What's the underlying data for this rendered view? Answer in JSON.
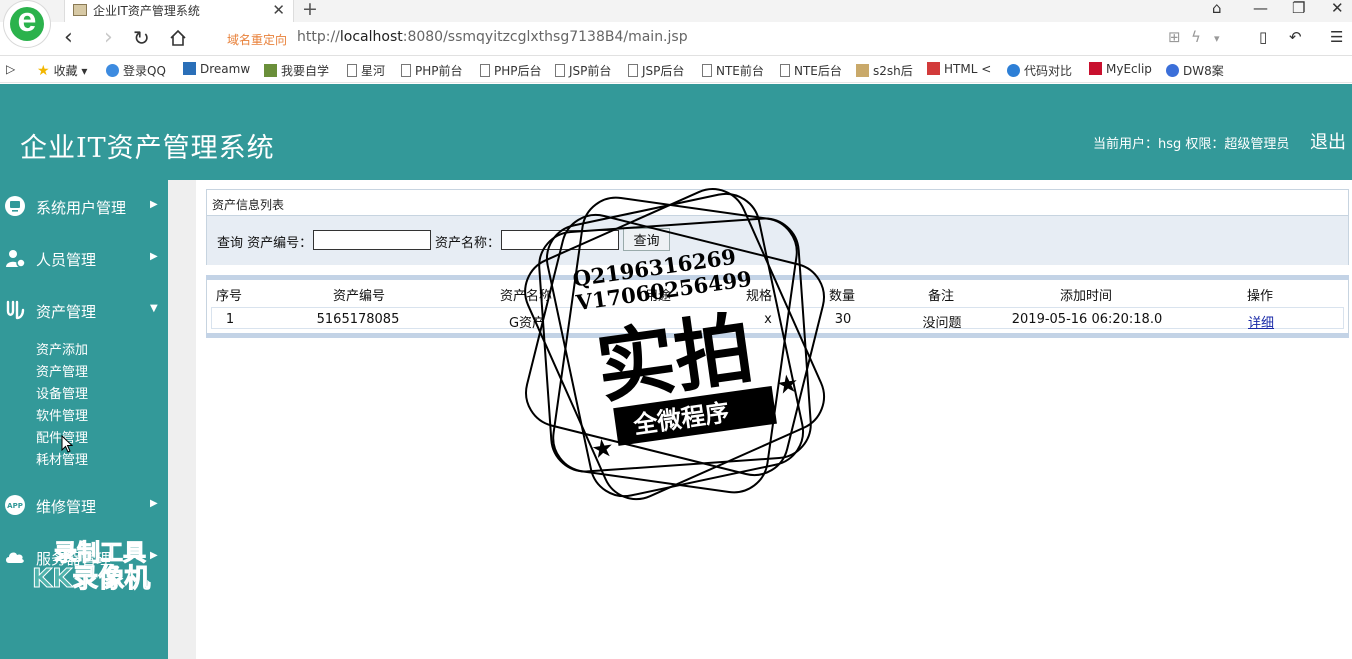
{
  "browser": {
    "tab_title": "企业IT资产管理系统",
    "new_tab": "+",
    "redirect_label": "域名重定向",
    "url_prefix": "http://",
    "url_host": "localhost",
    "url_rest": ":8080/ssmqyitzcglxthsg7138B4/main.jsp",
    "bookmarks": [
      "收藏",
      "登录QQ",
      "Dreamw",
      "我要自学",
      "星河",
      "PHP前台",
      "PHP后台",
      "JSP前台",
      "JSP后台",
      "NTE前台",
      "NTE后台",
      "s2sh后",
      "HTML <",
      "代码对比",
      "MyEclip",
      "DW8案"
    ]
  },
  "header": {
    "title": "企业IT资产管理系统",
    "user_info": "当前用户：hsg  权限：超级管理员",
    "logout": "退出"
  },
  "sidebar": {
    "menus": [
      {
        "label": "系统用户管理",
        "icon": "monitor-icon",
        "expanded": false
      },
      {
        "label": "人员管理",
        "icon": "users-icon",
        "expanded": false
      },
      {
        "label": "资产管理",
        "icon": "asset-icon",
        "expanded": true
      },
      {
        "label": "维修管理",
        "icon": "app-icon",
        "expanded": false
      },
      {
        "label": "服务器管理",
        "icon": "cloud-icon",
        "expanded": false
      }
    ],
    "submenu": [
      "资产添加",
      "资产管理",
      "设备管理",
      "软件管理",
      "配件管理",
      "耗材管理"
    ]
  },
  "panel": {
    "title": "资产信息列表",
    "search_prefix": "查询",
    "label_code": "资产编号：",
    "label_name": "资产名称：",
    "input_code_value": "",
    "input_name_value": "",
    "search_button": "查询"
  },
  "table": {
    "columns": [
      "序号",
      "资产编号",
      "资产名称",
      "用途",
      "规格",
      "数量",
      "备注",
      "添加时间",
      "操作"
    ],
    "rows": [
      {
        "no": "1",
        "code": "5165178085",
        "name": "G资产",
        "use": "",
        "spec": "x",
        "qty": "30",
        "remark": "没问题",
        "time": "2019-05-16 06:20:18.0",
        "action": "详细"
      }
    ]
  },
  "overlays": {
    "stamp_line1": "Q2196316269",
    "stamp_line2": "V17060256499",
    "stamp_big": "实拍",
    "stamp_banner": "全微程序",
    "recorder_l1": "录制工具",
    "recorder_l2": "KK录像机"
  }
}
